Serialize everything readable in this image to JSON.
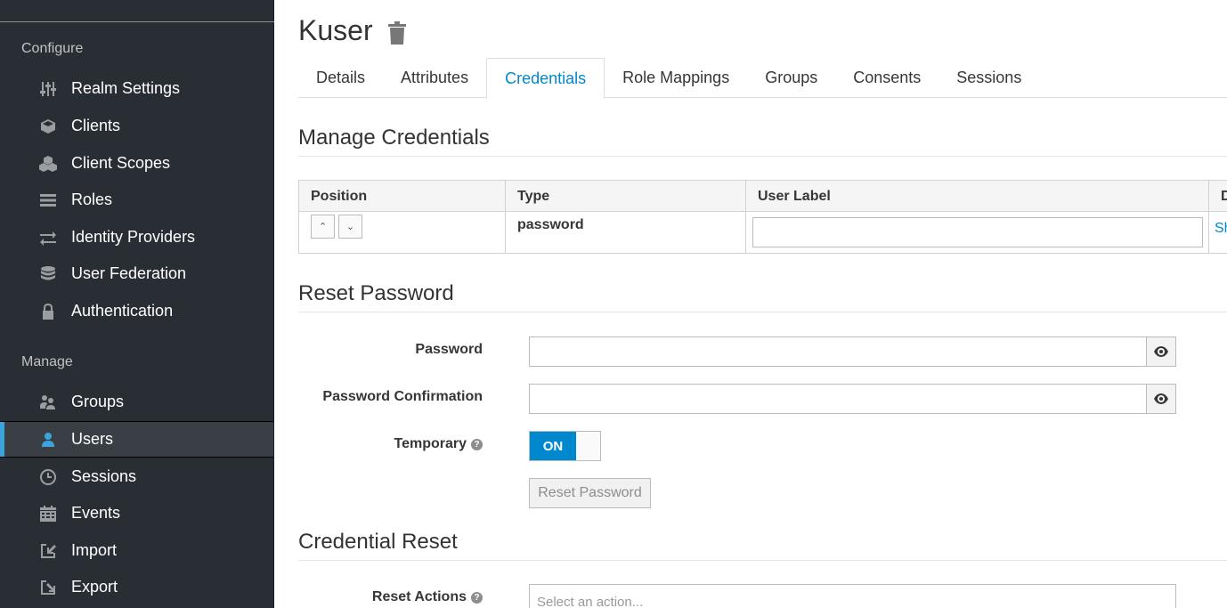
{
  "sidebar": {
    "configure_title": "Configure",
    "manage_title": "Manage",
    "configure_items": [
      {
        "label": "Realm Settings",
        "icon": "sliders-icon"
      },
      {
        "label": "Clients",
        "icon": "cube-icon"
      },
      {
        "label": "Client Scopes",
        "icon": "cubes-icon"
      },
      {
        "label": "Roles",
        "icon": "list-icon"
      },
      {
        "label": "Identity Providers",
        "icon": "exchange-icon"
      },
      {
        "label": "User Federation",
        "icon": "database-icon"
      },
      {
        "label": "Authentication",
        "icon": "lock-icon"
      }
    ],
    "manage_items": [
      {
        "label": "Groups",
        "icon": "users-icon"
      },
      {
        "label": "Users",
        "icon": "user-icon",
        "active": true
      },
      {
        "label": "Sessions",
        "icon": "clock-icon"
      },
      {
        "label": "Events",
        "icon": "calendar-icon"
      },
      {
        "label": "Import",
        "icon": "import-icon"
      },
      {
        "label": "Export",
        "icon": "export-icon"
      }
    ]
  },
  "header": {
    "title": "Kuser",
    "delete_icon": "trash-icon"
  },
  "tabs": [
    {
      "label": "Details"
    },
    {
      "label": "Attributes"
    },
    {
      "label": "Credentials",
      "active": true
    },
    {
      "label": "Role Mappings"
    },
    {
      "label": "Groups"
    },
    {
      "label": "Consents"
    },
    {
      "label": "Sessions"
    }
  ],
  "manage_credentials": {
    "heading": "Manage Credentials",
    "columns": [
      "Position",
      "Type",
      "User Label",
      "D"
    ],
    "rows": [
      {
        "type": "password",
        "user_label": "",
        "action": "Sh"
      }
    ]
  },
  "reset_password": {
    "heading": "Reset Password",
    "password_label": "Password",
    "password_value": "",
    "confirm_label": "Password Confirmation",
    "confirm_value": "",
    "temporary_label": "Temporary",
    "temporary_state": "ON",
    "button_label": "Reset Password"
  },
  "credential_reset": {
    "heading": "Credential Reset",
    "reset_actions_label": "Reset Actions",
    "reset_actions_placeholder": "Select an action..."
  },
  "colors": {
    "sidebar_bg": "#292e34",
    "accent": "#0088ce",
    "active_bar": "#39a5dc"
  }
}
